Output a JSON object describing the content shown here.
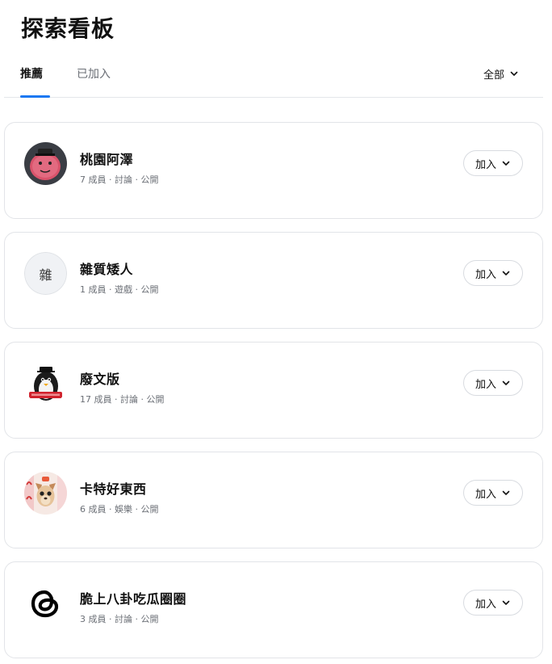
{
  "page_title": "探索看板",
  "tabs": [
    {
      "label": "推薦"
    },
    {
      "label": "已加入"
    }
  ],
  "filter": {
    "label": "全部",
    "icon": "chevron-down-icon"
  },
  "accent_color": "#1877f2",
  "boards": [
    {
      "name": "桃園阿澤",
      "meta": "7 成員 · 討論 · 公開",
      "join_label": "加入",
      "avatar": "pink-mascot-image"
    },
    {
      "name": "雜質矮人",
      "meta": "1 成員 · 遊戲 · 公開",
      "join_label": "加入",
      "avatar_text": "雜"
    },
    {
      "name": "廢文版",
      "meta": "17 成員 · 討論 · 公開",
      "join_label": "加入",
      "avatar": "penguin-sticker-image"
    },
    {
      "name": "卡特好東西",
      "meta": "6 成員 · 娛樂 · 公開",
      "join_label": "加入",
      "avatar": "chihuahua-photo-image"
    },
    {
      "name": "脆上八卦吃瓜圈圈",
      "meta": "3 成員 · 討論 · 公開",
      "join_label": "加入",
      "avatar": "threads-logo-icon"
    }
  ]
}
